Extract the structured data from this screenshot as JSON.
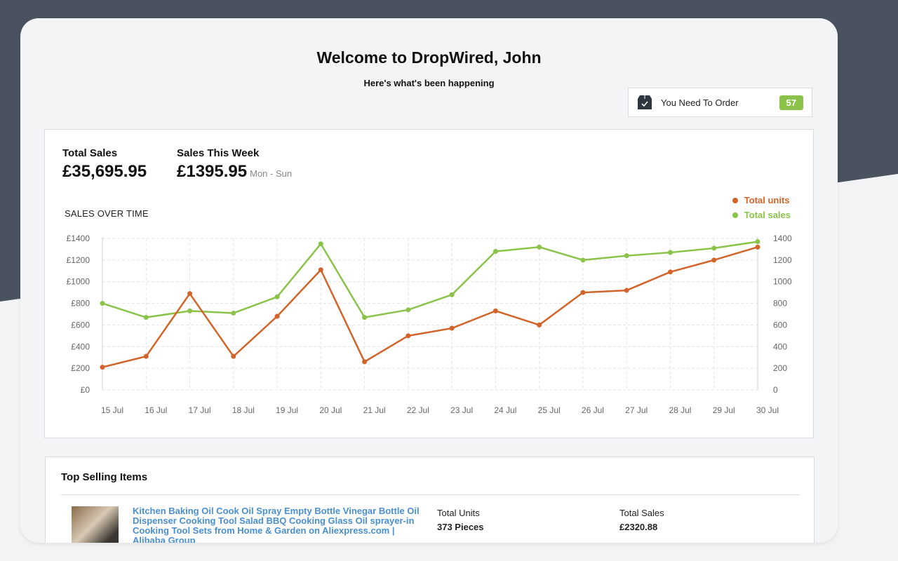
{
  "header": {
    "title": "Welcome to DropWired, John",
    "subtitle": "Here's what's been happening"
  },
  "order_widget": {
    "icon": "package-icon",
    "label": "You Need To Order",
    "count": "57"
  },
  "stats": {
    "total_sales_label": "Total Sales",
    "total_sales_value": "£35,695.95",
    "week_label": "Sales This Week",
    "week_value": "£1395.95",
    "week_range": "Mon - Sun"
  },
  "colors": {
    "units": "#d2642a",
    "sales": "#8bc34a",
    "accent": "#4a8fd0",
    "dark_bg": "#4a5260"
  },
  "chart_data": {
    "type": "line",
    "title": "SALES OVER TIME",
    "categories": [
      "15 Jul",
      "16 Jul",
      "17 Jul",
      "18 Jul",
      "19 Jul",
      "20 Jul",
      "21 Jul",
      "22 Jul",
      "23 Jul",
      "24 Jul",
      "25 Jul",
      "26 Jul",
      "27 Jul",
      "28 Jul",
      "29 Jul",
      "30 Jul"
    ],
    "series": [
      {
        "name": "Total units",
        "values": [
          210,
          310,
          890,
          310,
          680,
          1110,
          260,
          500,
          570,
          730,
          600,
          900,
          920,
          1090,
          1200,
          1320
        ]
      },
      {
        "name": "Total sales",
        "values": [
          800,
          670,
          730,
          710,
          860,
          1350,
          670,
          740,
          880,
          1280,
          1320,
          1200,
          1240,
          1270,
          1310,
          1370
        ]
      }
    ],
    "y_ticks_left": [
      "£0",
      "£200",
      "£400",
      "£600",
      "£800",
      "£1000",
      "£1200",
      "£1400"
    ],
    "y_ticks_right": [
      "0",
      "200",
      "400",
      "600",
      "800",
      "1000",
      "1200",
      "1400"
    ],
    "ylim": [
      0,
      1400
    ],
    "grid": true,
    "legend_position": "top-right"
  },
  "top_selling": {
    "title": "Top Selling Items",
    "items": [
      {
        "name": "Kitchen Baking Oil Cook Oil Spray Empty Bottle Vinegar Bottle Oil Dispenser Cooking Tool Salad BBQ Cooking Glass Oil sprayer-in Cooking Tool Sets from Home & Garden on Aliexpress.com | Alibaba Group",
        "units_label": "Total Units",
        "units_value": "373 Pieces",
        "sales_label": "Total Sales",
        "sales_value": "£2320.88"
      }
    ]
  }
}
